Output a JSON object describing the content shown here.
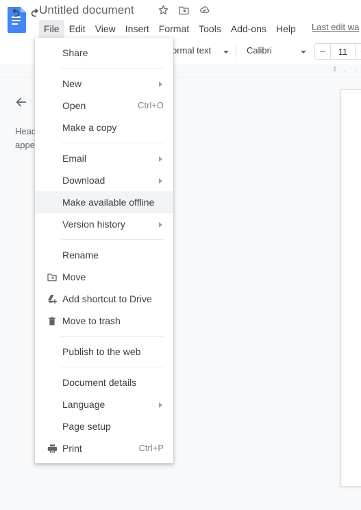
{
  "header": {
    "logo_icon": "google-docs-logo",
    "doc_title": "Untitled document",
    "title_icons": [
      {
        "name": "star-icon",
        "label": "Star"
      },
      {
        "name": "move-to-folder-icon",
        "label": "Move to folder"
      },
      {
        "name": "cloud-saved-icon",
        "label": "Saved to Drive"
      }
    ],
    "menus": [
      {
        "label": "File",
        "active": true
      },
      {
        "label": "Edit",
        "active": false
      },
      {
        "label": "View",
        "active": false
      },
      {
        "label": "Insert",
        "active": false
      },
      {
        "label": "Format",
        "active": false
      },
      {
        "label": "Tools",
        "active": false
      },
      {
        "label": "Add-ons",
        "active": false
      },
      {
        "label": "Help",
        "active": false
      }
    ],
    "last_edit": "Last edit wa"
  },
  "toolbar": {
    "undo_icon": "undo-icon",
    "redo_icon": "redo-icon",
    "paragraph_style": "ormal text",
    "font_family": "Calibri",
    "font_size": "11",
    "font_size_decrease": "−",
    "font_size_increase": "+"
  },
  "ruler": {
    "page_marker": "1"
  },
  "outline": {
    "back_icon": "back-arrow-icon",
    "empty_text": "Head\nappe"
  },
  "file_menu": {
    "items": [
      {
        "type": "item",
        "label": "Share",
        "icon": null,
        "accel": null,
        "submenu": false,
        "highlight": false
      },
      {
        "type": "divider"
      },
      {
        "type": "item",
        "label": "New",
        "icon": null,
        "accel": null,
        "submenu": true,
        "highlight": false
      },
      {
        "type": "item",
        "label": "Open",
        "icon": null,
        "accel": "Ctrl+O",
        "submenu": false,
        "highlight": false
      },
      {
        "type": "item",
        "label": "Make a copy",
        "icon": null,
        "accel": null,
        "submenu": false,
        "highlight": false
      },
      {
        "type": "divider"
      },
      {
        "type": "item",
        "label": "Email",
        "icon": null,
        "accel": null,
        "submenu": true,
        "highlight": false
      },
      {
        "type": "item",
        "label": "Download",
        "icon": null,
        "accel": null,
        "submenu": true,
        "highlight": false
      },
      {
        "type": "item",
        "label": "Make available offline",
        "icon": null,
        "accel": null,
        "submenu": false,
        "highlight": true
      },
      {
        "type": "item",
        "label": "Version history",
        "icon": null,
        "accel": null,
        "submenu": true,
        "highlight": false
      },
      {
        "type": "divider"
      },
      {
        "type": "item",
        "label": "Rename",
        "icon": null,
        "accel": null,
        "submenu": false,
        "highlight": false
      },
      {
        "type": "item",
        "label": "Move",
        "icon": "move-folder-icon",
        "accel": null,
        "submenu": false,
        "highlight": false
      },
      {
        "type": "item",
        "label": "Add shortcut to Drive",
        "icon": "drive-shortcut-icon",
        "accel": null,
        "submenu": false,
        "highlight": false
      },
      {
        "type": "item",
        "label": "Move to trash",
        "icon": "trash-icon",
        "accel": null,
        "submenu": false,
        "highlight": false
      },
      {
        "type": "divider"
      },
      {
        "type": "item",
        "label": "Publish to the web",
        "icon": null,
        "accel": null,
        "submenu": false,
        "highlight": false
      },
      {
        "type": "divider"
      },
      {
        "type": "item",
        "label": "Document details",
        "icon": null,
        "accel": null,
        "submenu": false,
        "highlight": false
      },
      {
        "type": "item",
        "label": "Language",
        "icon": null,
        "accel": null,
        "submenu": true,
        "highlight": false
      },
      {
        "type": "item",
        "label": "Page setup",
        "icon": null,
        "accel": null,
        "submenu": false,
        "highlight": false
      },
      {
        "type": "item",
        "label": "Print",
        "icon": "print-icon",
        "accel": "Ctrl+P",
        "submenu": false,
        "highlight": false
      }
    ]
  },
  "colors": {
    "docs_blue": "#4285f4",
    "menu_highlight": "#f1f3f4",
    "active_menu_bg": "#e8eaed",
    "text_primary": "#3c4043",
    "text_secondary": "#5f6368",
    "canvas_bg": "#f8f9fa"
  }
}
